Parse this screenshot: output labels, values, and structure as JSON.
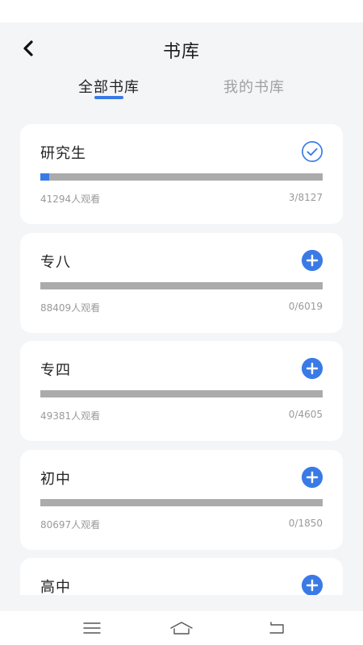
{
  "header": {
    "title": "书库",
    "back_icon": "chevron-left-icon"
  },
  "tabs": [
    {
      "label": "全部书库",
      "active": true
    },
    {
      "label": "我的书库",
      "active": false
    }
  ],
  "colors": {
    "accent": "#3a7ae6",
    "track": "#ababab",
    "background": "#f4f5f7",
    "card": "#ffffff"
  },
  "books": [
    {
      "name": "研究生",
      "viewers": "41294人观看",
      "count": "3/8127",
      "progress": 0.03,
      "status": "added",
      "icon": "check-circle-icon"
    },
    {
      "name": "专八",
      "viewers": "88409人观看",
      "count": "0/6019",
      "progress": 0,
      "status": "not-added",
      "icon": "plus-circle-icon"
    },
    {
      "name": "专四",
      "viewers": "49381人观看",
      "count": "0/4605",
      "progress": 0,
      "status": "not-added",
      "icon": "plus-circle-icon"
    },
    {
      "name": "初中",
      "viewers": "80697人观看",
      "count": "0/1850",
      "progress": 0,
      "status": "not-added",
      "icon": "plus-circle-icon"
    },
    {
      "name": "高中",
      "status": "not-added",
      "icon": "plus-circle-icon"
    }
  ],
  "nav_bar": {
    "icons": [
      "menu-icon",
      "home-icon",
      "back-icon"
    ]
  }
}
